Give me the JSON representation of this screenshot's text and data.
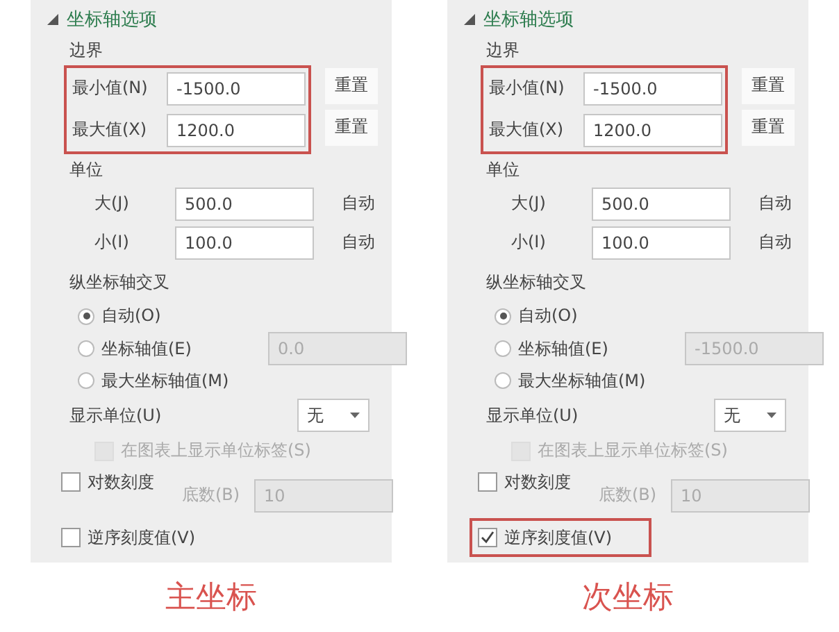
{
  "panels": [
    {
      "section": {
        "title": "坐标轴选项",
        "expanded": true
      },
      "bounds": {
        "title": "边界",
        "highlighted": true,
        "rows": [
          {
            "label": "最小值(N)",
            "value": "-1500.0",
            "button": "重置"
          },
          {
            "label": "最大值(X)",
            "value": "1200.0",
            "button": "重置"
          }
        ]
      },
      "units": {
        "title": "单位",
        "rows": [
          {
            "label": "大(J)",
            "value": "500.0",
            "note": "自动"
          },
          {
            "label": "小(I)",
            "value": "100.0",
            "note": "自动"
          }
        ]
      },
      "crosses": {
        "title": "纵坐标轴交叉",
        "options": [
          {
            "label": "自动(O)",
            "selected": true
          },
          {
            "label": "坐标轴值(E)",
            "selected": false,
            "value": "0.0"
          },
          {
            "label": "最大坐标轴值(M)",
            "selected": false
          }
        ]
      },
      "display_units": {
        "label": "显示单位(U)",
        "value": "无"
      },
      "show_label": {
        "label": "在图表上显示单位标签(S)",
        "checked": false,
        "disabled": true
      },
      "log_scale": {
        "label": "对数刻度",
        "checked": false,
        "base_label": "底数(B)",
        "base_value": "10"
      },
      "reverse": {
        "label": "逆序刻度值(V)",
        "checked": false,
        "highlighted": false
      },
      "caption": "主坐标"
    },
    {
      "section": {
        "title": "坐标轴选项",
        "expanded": true
      },
      "bounds": {
        "title": "边界",
        "highlighted": true,
        "rows": [
          {
            "label": "最小值(N)",
            "value": "-1500.0",
            "button": "重置"
          },
          {
            "label": "最大值(X)",
            "value": "1200.0",
            "button": "重置"
          }
        ]
      },
      "units": {
        "title": "单位",
        "rows": [
          {
            "label": "大(J)",
            "value": "500.0",
            "note": "自动"
          },
          {
            "label": "小(I)",
            "value": "100.0",
            "note": "自动"
          }
        ]
      },
      "crosses": {
        "title": "纵坐标轴交叉",
        "options": [
          {
            "label": "自动(O)",
            "selected": true
          },
          {
            "label": "坐标轴值(E)",
            "selected": false,
            "value": "-1500.0"
          },
          {
            "label": "最大坐标轴值(M)",
            "selected": false
          }
        ]
      },
      "display_units": {
        "label": "显示单位(U)",
        "value": "无"
      },
      "show_label": {
        "label": "在图表上显示单位标签(S)",
        "checked": false,
        "disabled": true
      },
      "log_scale": {
        "label": "对数刻度",
        "checked": false,
        "base_label": "底数(B)",
        "base_value": "10"
      },
      "reverse": {
        "label": "逆序刻度值(V)",
        "checked": true,
        "highlighted": true
      },
      "caption": "次坐标"
    }
  ]
}
